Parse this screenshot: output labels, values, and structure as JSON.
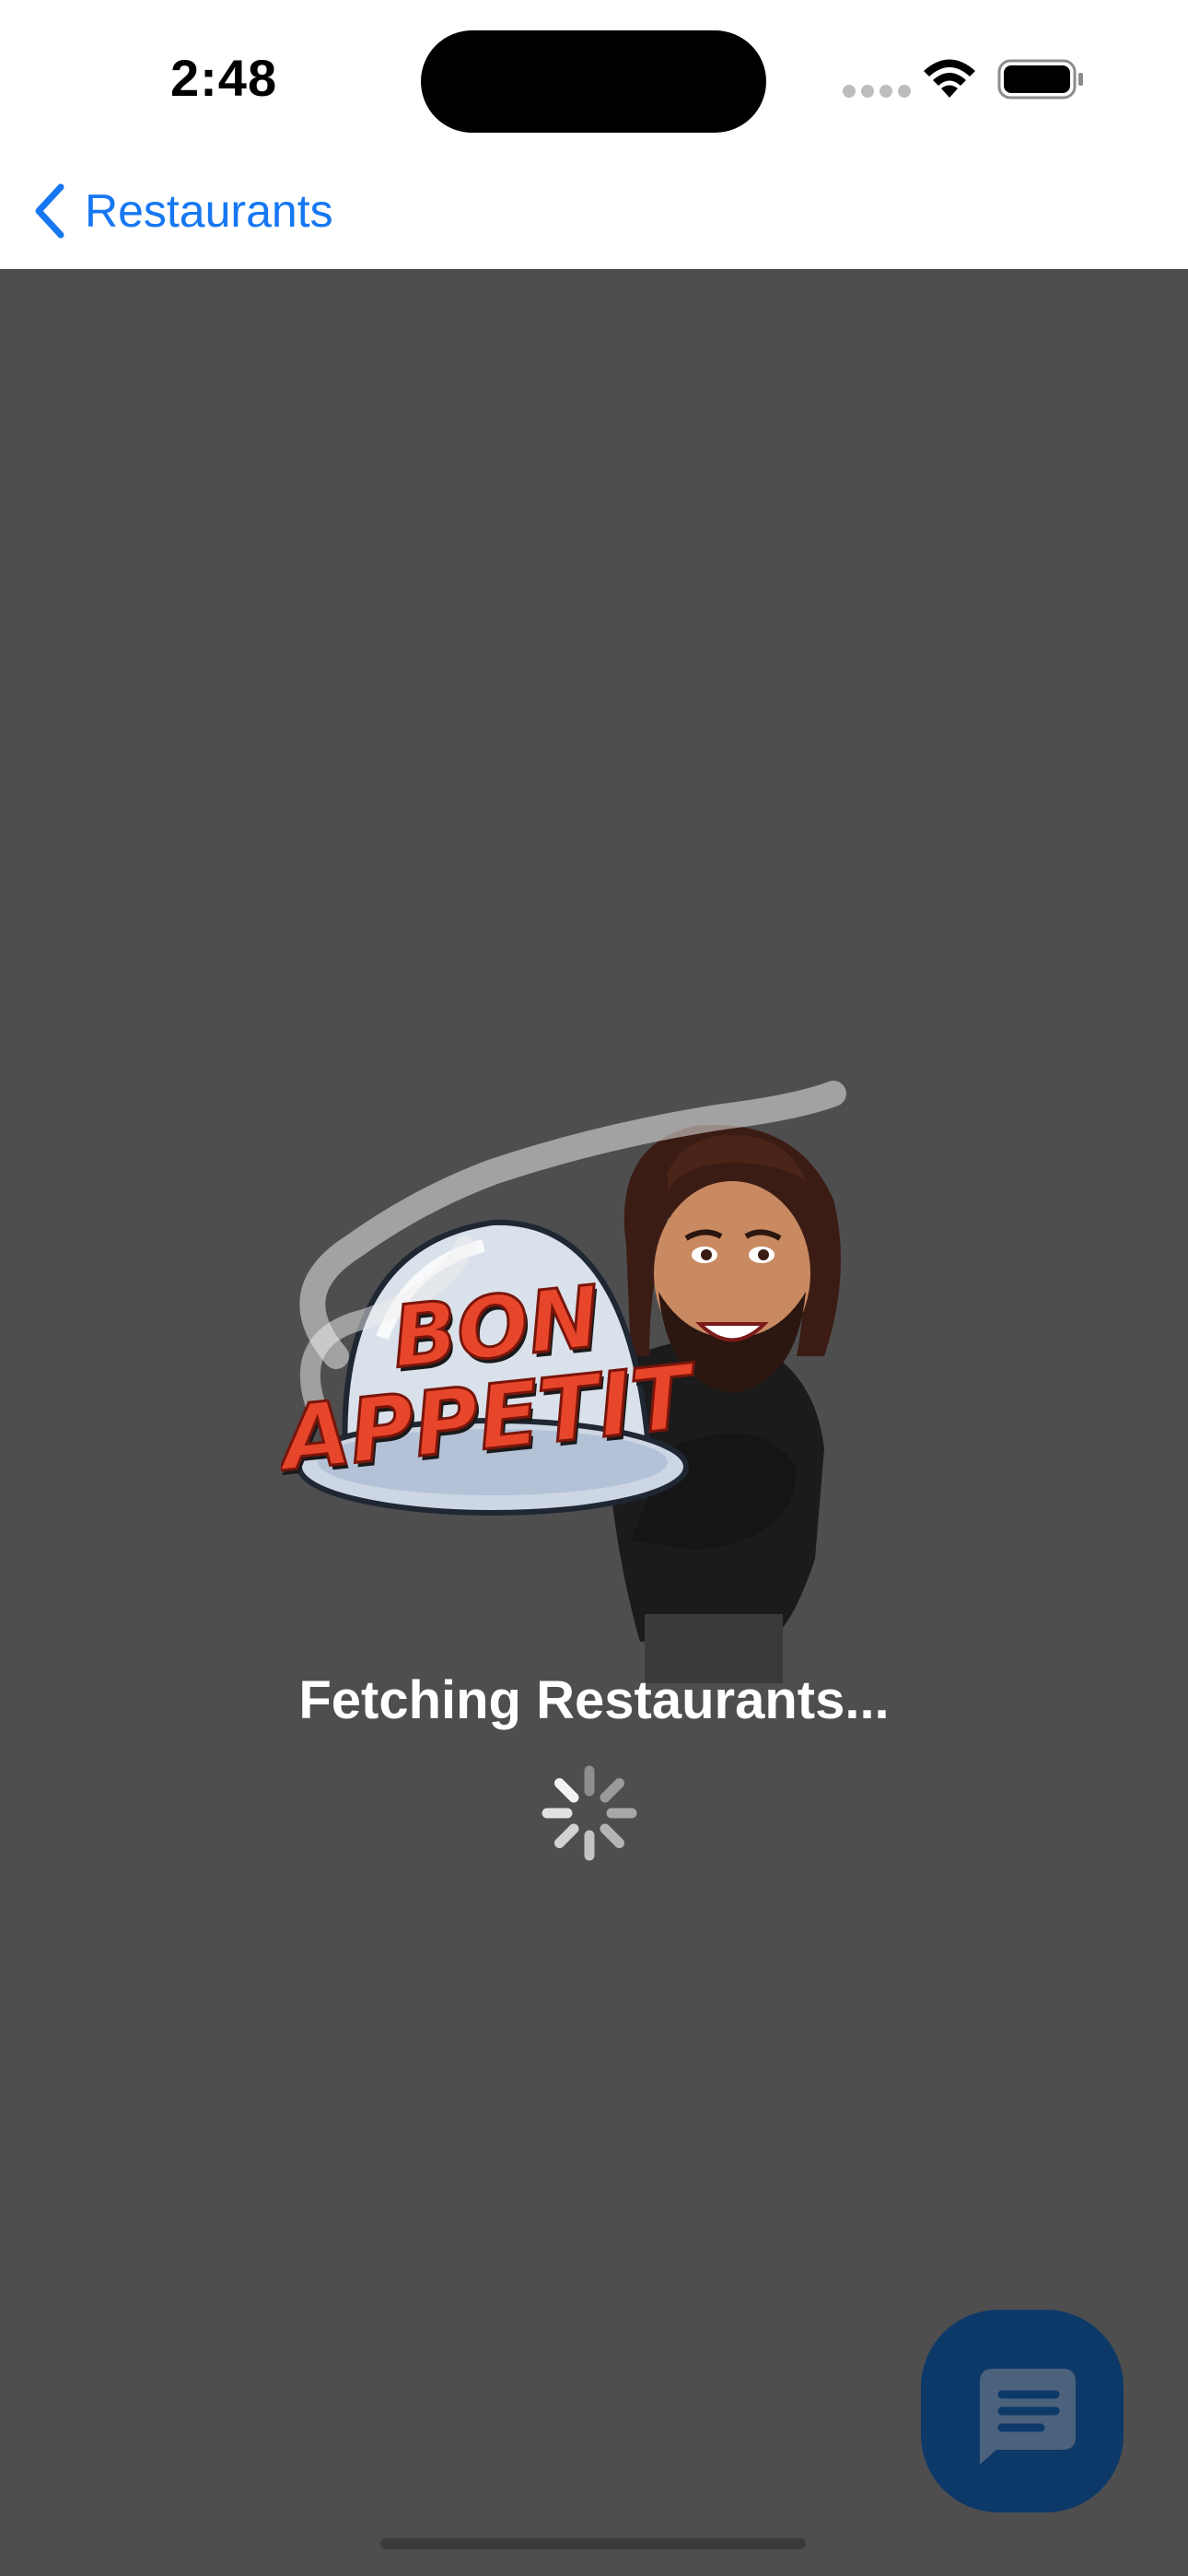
{
  "status_bar": {
    "time": "2:48",
    "signal_icon": "cellular-dots-icon",
    "wifi_icon": "wifi-icon",
    "battery_icon": "battery-icon"
  },
  "nav": {
    "back_label": "Restaurants",
    "back_icon": "chevron-left-icon",
    "accent_color": "#1677f2"
  },
  "loading": {
    "image": "bon-appetit-mascot",
    "image_text": "BON APPETIT",
    "message": "Fetching Restaurants...",
    "spinner_icon": "activity-spinner-icon"
  },
  "chat_button": {
    "icon": "chat-bubble-icon",
    "color": "#0d3969"
  },
  "colors": {
    "background": "#4e4e4f",
    "header": "#ffffff"
  }
}
